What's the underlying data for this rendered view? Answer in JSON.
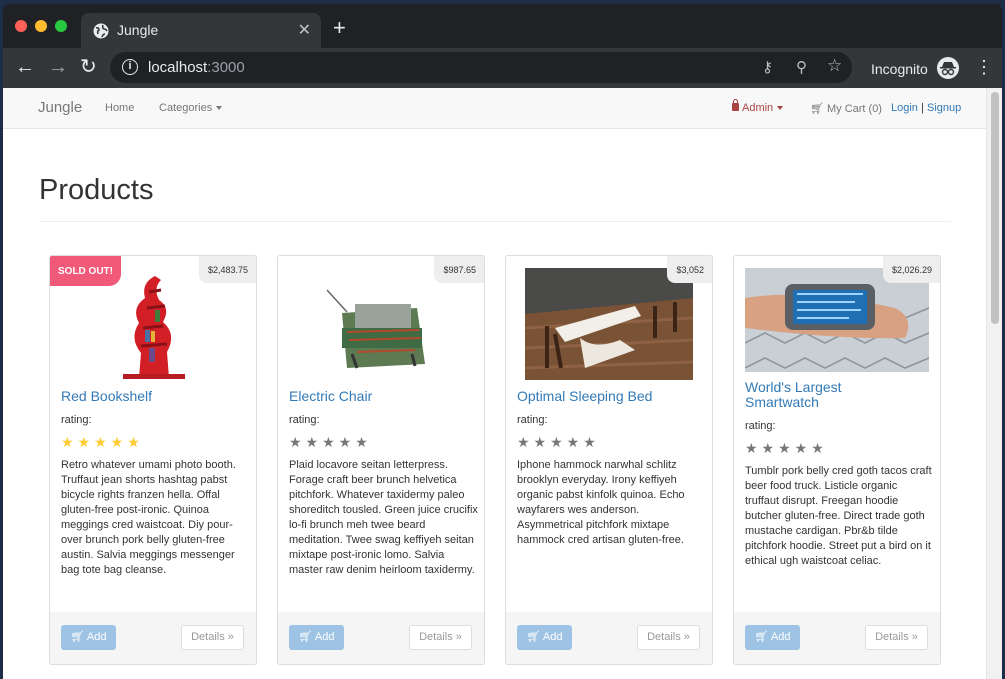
{
  "browser": {
    "tab_title": "Jungle",
    "url_host": "localhost",
    "url_port": ":3000",
    "incognito_label": "Incognito"
  },
  "navbar": {
    "brand": "Jungle",
    "home": "Home",
    "categories": "Categories",
    "admin": "Admin",
    "cart": "My Cart (0)",
    "login": "Login",
    "separator": "|",
    "signup": "Signup"
  },
  "page": {
    "title": "Products"
  },
  "products": [
    {
      "name": "Red Bookshelf",
      "price": "$2,483.75",
      "badge": "SOLD OUT!",
      "rating_label": "rating:",
      "stars": "★★★★★",
      "rating": 5,
      "description": "Retro whatever umami photo booth. Truffaut jean shorts hashtag pabst bicycle rights franzen hella. Offal gluten-free post-ironic. Quinoa meggings cred waistcoat. Diy pour-over brunch pork belly gluten-free austin. Salvia meggings messenger bag tote bag cleanse.",
      "add_label": "Add",
      "details_label": "Details »"
    },
    {
      "name": "Electric Chair",
      "price": "$987.65",
      "rating_label": "rating:",
      "stars": "★★★★★",
      "rating": 0,
      "description": "Plaid locavore seitan letterpress. Forage craft beer brunch helvetica pitchfork. Whatever taxidermy paleo shoreditch tousled. Green juice crucifix lo-fi brunch meh twee beard meditation. Twee swag keffiyeh seitan mixtape post-ironic lomo. Salvia master raw denim heirloom taxidermy.",
      "add_label": "Add",
      "details_label": "Details »"
    },
    {
      "name": "Optimal Sleeping Bed",
      "price": "$3,052",
      "rating_label": "rating:",
      "stars": "★★★★★",
      "rating": 0,
      "description": "Iphone hammock narwhal schlitz brooklyn everyday. Irony keffiyeh organic pabst kinfolk quinoa. Echo wayfarers wes anderson. Asymmetrical pitchfork mixtape hammock cred artisan gluten-free.",
      "add_label": "Add",
      "details_label": "Details »"
    },
    {
      "name": "World's Largest Smartwatch",
      "price": "$2,026.29",
      "rating_label": "rating:",
      "stars": "★★★★★",
      "rating": 0,
      "description": "Tumblr pork belly cred goth tacos craft beer food truck. Listicle organic truffaut disrupt. Freegan hoodie butcher gluten-free. Direct trade goth mustache cardigan. Pbr&b tilde pitchfork hoodie. Street put a bird on it ethical ugh waistcoat celiac.",
      "add_label": "Add",
      "details_label": "Details »"
    }
  ]
}
